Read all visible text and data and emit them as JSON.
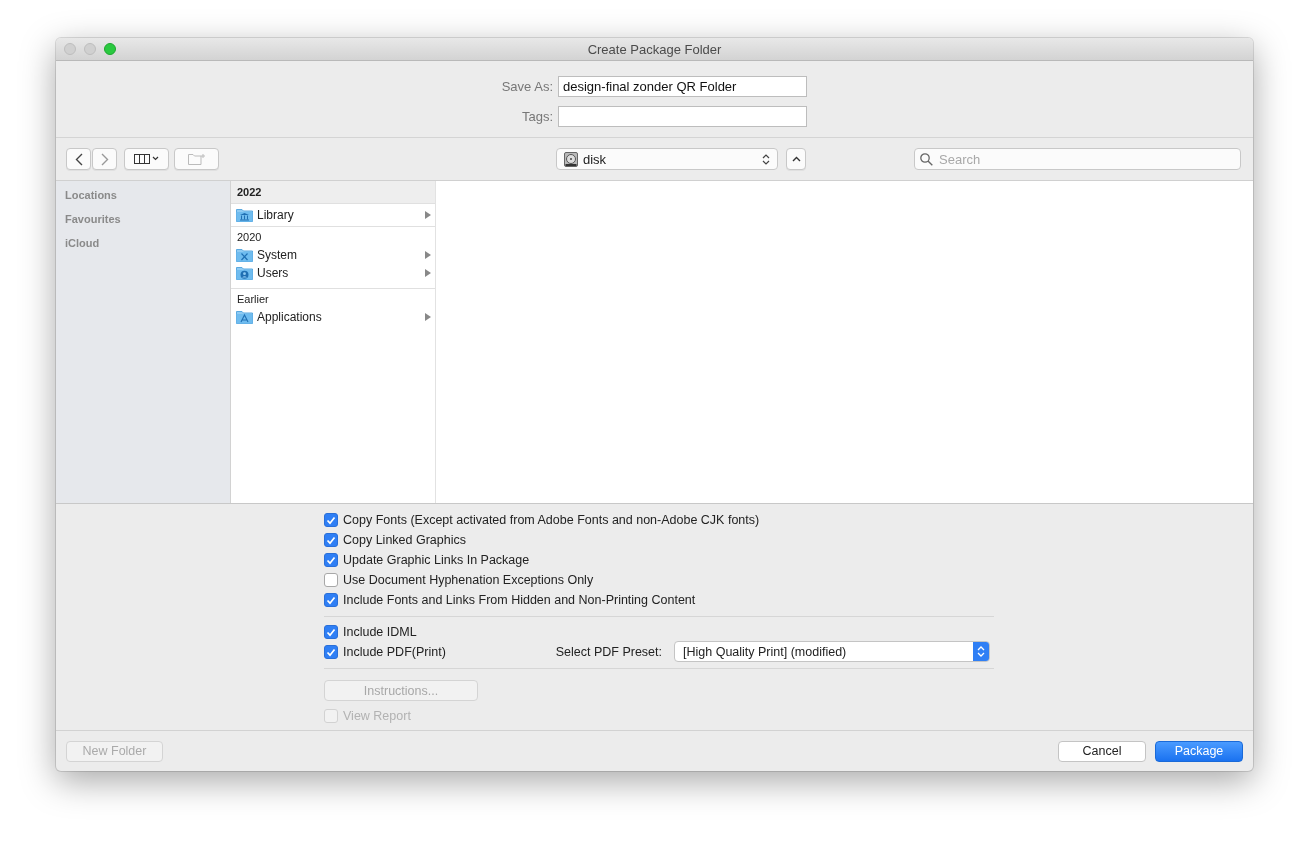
{
  "window": {
    "title": "Create Package Folder"
  },
  "save_as": {
    "label": "Save As:",
    "value": "design-final zonder QR Folder"
  },
  "tags": {
    "label": "Tags:"
  },
  "toolbar": {
    "location": "disk",
    "search": {
      "placeholder": "Search"
    }
  },
  "sidebar": {
    "items": [
      {
        "label": "Locations"
      },
      {
        "label": "Favourites"
      },
      {
        "label": "iCloud"
      }
    ]
  },
  "browser": {
    "groups": [
      {
        "heading": "2022",
        "pinned": true,
        "items": [
          {
            "name": "Library",
            "kind": "library"
          }
        ]
      },
      {
        "heading": "2020",
        "pinned": false,
        "items": [
          {
            "name": "System",
            "kind": "system"
          },
          {
            "name": "Users",
            "kind": "users"
          }
        ]
      },
      {
        "heading": "Earlier",
        "pinned": false,
        "items": [
          {
            "name": "Applications",
            "kind": "applications"
          }
        ]
      }
    ]
  },
  "options": {
    "package_checks": [
      {
        "label": "Copy Fonts (Except activated from Adobe Fonts and non-Adobe CJK fonts)",
        "checked": true,
        "disabled": false
      },
      {
        "label": "Copy Linked Graphics",
        "checked": true,
        "disabled": false
      },
      {
        "label": "Update Graphic Links In Package",
        "checked": true,
        "disabled": false
      },
      {
        "label": "Use Document Hyphenation Exceptions Only",
        "checked": false,
        "disabled": false
      },
      {
        "label": "Include Fonts and Links From Hidden and Non-Printing Content",
        "checked": true,
        "disabled": false
      }
    ],
    "export_checks": [
      {
        "label": "Include IDML",
        "checked": true,
        "disabled": false
      },
      {
        "label": "Include PDF(Print)",
        "checked": true,
        "disabled": false
      }
    ],
    "pdf_preset": {
      "label": "Select PDF Preset:",
      "value": "[High Quality Print] (modified)"
    },
    "instructions_button": {
      "label": "Instructions...",
      "disabled": true
    },
    "view_report": {
      "label": "View Report",
      "checked": false,
      "disabled": true
    }
  },
  "footer": {
    "new_folder_button": {
      "label": "New Folder",
      "disabled": true
    },
    "buttons": [
      {
        "label": "Cancel",
        "kind": "secondary"
      },
      {
        "label": "Package",
        "kind": "primary"
      }
    ]
  }
}
